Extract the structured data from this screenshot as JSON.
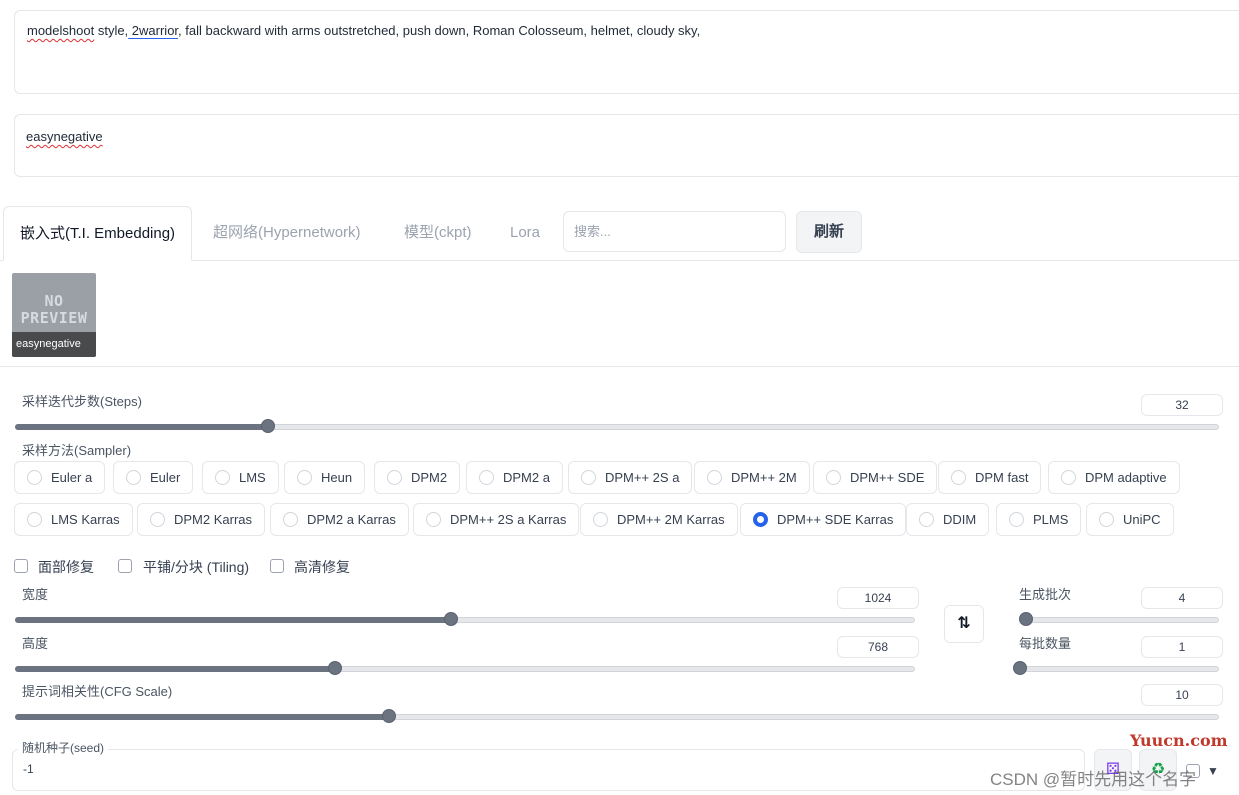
{
  "prompts": {
    "positive_pre": "modelshoot",
    "positive_mid": " style,",
    "positive_misspelled": " 2warrior",
    "positive_rest": ", fall backward with arms outstretched, push down, Roman Colosseum, helmet, cloudy sky,",
    "negative": "easynegative"
  },
  "tabs": [
    {
      "label": "嵌入式(T.I. Embedding)",
      "active": true
    },
    {
      "label": "超网络(Hypernetwork)",
      "active": false
    },
    {
      "label": "模型(ckpt)",
      "active": false
    },
    {
      "label": "Lora",
      "active": false
    }
  ],
  "search": {
    "placeholder": "搜索..."
  },
  "refresh_label": "刷新",
  "cards": [
    {
      "preview_text_1": "NO",
      "preview_text_2": "PREVIEW",
      "name": "easynegative"
    }
  ],
  "steps": {
    "label": "采样迭代步数(Steps)",
    "value": "32",
    "fraction": 0.21
  },
  "sampler": {
    "label": "采样方法(Sampler)",
    "selected": "DPM++ SDE Karras",
    "options_row1": [
      "Euler a",
      "Euler",
      "LMS",
      "Heun",
      "DPM2",
      "DPM2 a",
      "DPM++ 2S a",
      "DPM++ 2M",
      "DPM++ SDE",
      "DPM fast",
      "DPM adaptive"
    ],
    "options_row2": [
      "LMS Karras",
      "DPM2 Karras",
      "DPM2 a Karras",
      "DPM++ 2S a Karras",
      "DPM++ 2M Karras",
      "DPM++ SDE Karras",
      "DDIM",
      "PLMS",
      "UniPC"
    ]
  },
  "checkboxes": [
    {
      "label": "面部修复",
      "checked": false
    },
    {
      "label": "平铺/分块 (Tiling)",
      "checked": false
    },
    {
      "label": "高清修复",
      "checked": false
    }
  ],
  "width": {
    "label": "宽度",
    "value": "1024",
    "fraction": 0.484
  },
  "height": {
    "label": "高度",
    "value": "768",
    "fraction": 0.355
  },
  "batch_count": {
    "label": "生成批次",
    "value": "4",
    "fraction": 0.03
  },
  "batch_size": {
    "label": "每批数量",
    "value": "1",
    "fraction": 0.0
  },
  "cfg": {
    "label": "提示词相关性(CFG Scale)",
    "value": "10",
    "fraction": 0.311
  },
  "seed": {
    "label": "随机种子(seed)",
    "value": "-1"
  },
  "swap_icon": "swap-vertical-icon",
  "watermark": {
    "site": "Yuucn.com",
    "csdn": "CSDN @暂时先用这个名字"
  },
  "colors": {
    "accent": "#2563eb",
    "slider_fill": "#6b7280",
    "watermark_red": "#c0392b"
  }
}
